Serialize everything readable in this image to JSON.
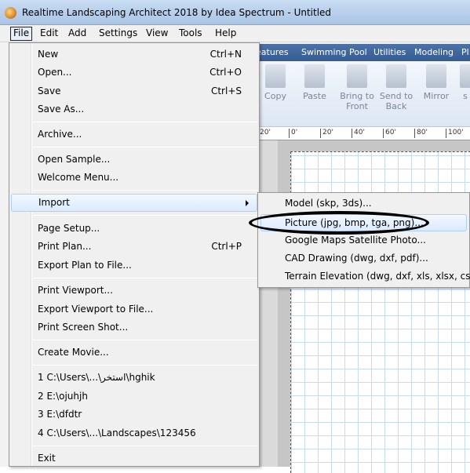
{
  "window": {
    "title": "Realtime Landscaping Architect 2018 by Idea Spectrum - Untitled"
  },
  "menubar": [
    "File",
    "Edit",
    "Add",
    "Settings",
    "View",
    "Tools",
    "Help"
  ],
  "ribbon": {
    "tabs": [
      "eatures",
      "Swimming Pool",
      "Utilities",
      "Modeling",
      "Pl"
    ],
    "tools": [
      "Copy",
      "Paste",
      "Bring to\nFront",
      "Send to\nBack",
      "Mirror",
      "s"
    ]
  },
  "ruler": [
    "20'",
    "0'",
    "20'",
    "40'",
    "60'",
    "80'",
    "100'"
  ],
  "file_menu": {
    "new": "New",
    "new_sc": "Ctrl+N",
    "open": "Open...",
    "open_sc": "Ctrl+O",
    "save": "Save",
    "save_sc": "Ctrl+S",
    "save_as": "Save As...",
    "archive": "Archive...",
    "open_sample": "Open Sample...",
    "welcome": "Welcome Menu...",
    "import": "Import",
    "page_setup": "Page Setup...",
    "print_plan": "Print Plan...",
    "print_plan_sc": "Ctrl+P",
    "export_plan": "Export Plan to File...",
    "print_viewport": "Print Viewport...",
    "export_viewport": "Export Viewport to File...",
    "print_screen": "Print Screen Shot...",
    "create_movie": "Create Movie...",
    "recent1": "1 C:\\Users\\...\\استخر\\hghik",
    "recent2": "2 E:\\ojuhjh",
    "recent3": "3 E:\\dfdtr",
    "recent4": "4 C:\\Users\\...\\Landscapes\\123456",
    "exit": "Exit"
  },
  "import_menu": {
    "model": "Model (skp, 3ds)...",
    "picture": "Picture (jpg, bmp, tga, png)...",
    "google_maps": "Google Maps Satellite Photo...",
    "cad": "CAD Drawing (dwg, dxf, pdf)...",
    "terrain": "Terrain Elevation (dwg, dxf, xls, xlsx, csv)..."
  },
  "colors": {
    "highlight": "#dbeaff",
    "ribbon_tab_bg": "#365d93",
    "grid": "#c7dcf3"
  }
}
